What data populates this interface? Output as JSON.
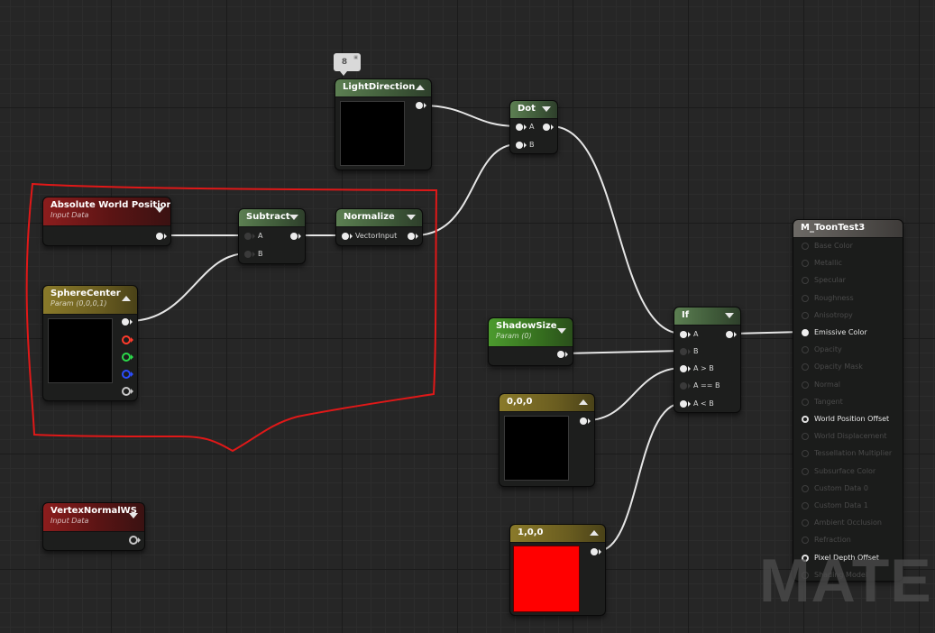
{
  "comment_bubble": {
    "number": "8",
    "icon_text": "8 ... 8"
  },
  "watermark": "MATER",
  "nodes": {
    "light_direction": {
      "title": "LightDirection"
    },
    "dot": {
      "title": "Dot",
      "pins": {
        "a": "A",
        "b": "B"
      }
    },
    "absolute_world_position": {
      "title": "Absolute World Position",
      "subtitle": "Input Data"
    },
    "subtract": {
      "title": "Subtract",
      "pins": {
        "a": "A",
        "b": "B"
      }
    },
    "normalize": {
      "title": "Normalize",
      "pins": {
        "vector_input": "VectorInput"
      }
    },
    "sphere_center": {
      "title": "SphereCenter",
      "subtitle": "Param (0,0,0,1)"
    },
    "shadow_size": {
      "title": "ShadowSize",
      "subtitle": "Param (0)"
    },
    "if_node": {
      "title": "If",
      "pins": {
        "a": "A",
        "b": "B",
        "a_gt_b": "A > B",
        "a_eq_b": "A == B",
        "a_lt_b": "A < B"
      }
    },
    "constant_000": {
      "title": "0,0,0"
    },
    "constant_100": {
      "title": "1,0,0"
    },
    "vertex_normal_ws": {
      "title": "VertexNormalWS",
      "subtitle": "Input Data"
    },
    "result": {
      "title": "M_ToonTest3",
      "pins": [
        "Base Color",
        "Metallic",
        "Specular",
        "Roughness",
        "Anisotropy",
        "Emissive Color",
        "Opacity",
        "Opacity Mask",
        "Normal",
        "Tangent",
        "World Position Offset",
        "World Displacement",
        "Tessellation Multiplier",
        "Subsurface Color",
        "Custom Data 0",
        "Custom Data 1",
        "Ambient Occlusion",
        "Refraction",
        "Pixel Depth Offset",
        "Shading Model"
      ]
    }
  },
  "colors": {
    "input_data_header": "#8c1d1d",
    "math_header": "#5c7f52",
    "vector_param_header": "#8a7a2a",
    "scalar_param_header": "#4c9b2e",
    "result_header": "#6d6a66",
    "selection_stroke": "#e01818",
    "constant_red_preview": "#ff0000"
  }
}
